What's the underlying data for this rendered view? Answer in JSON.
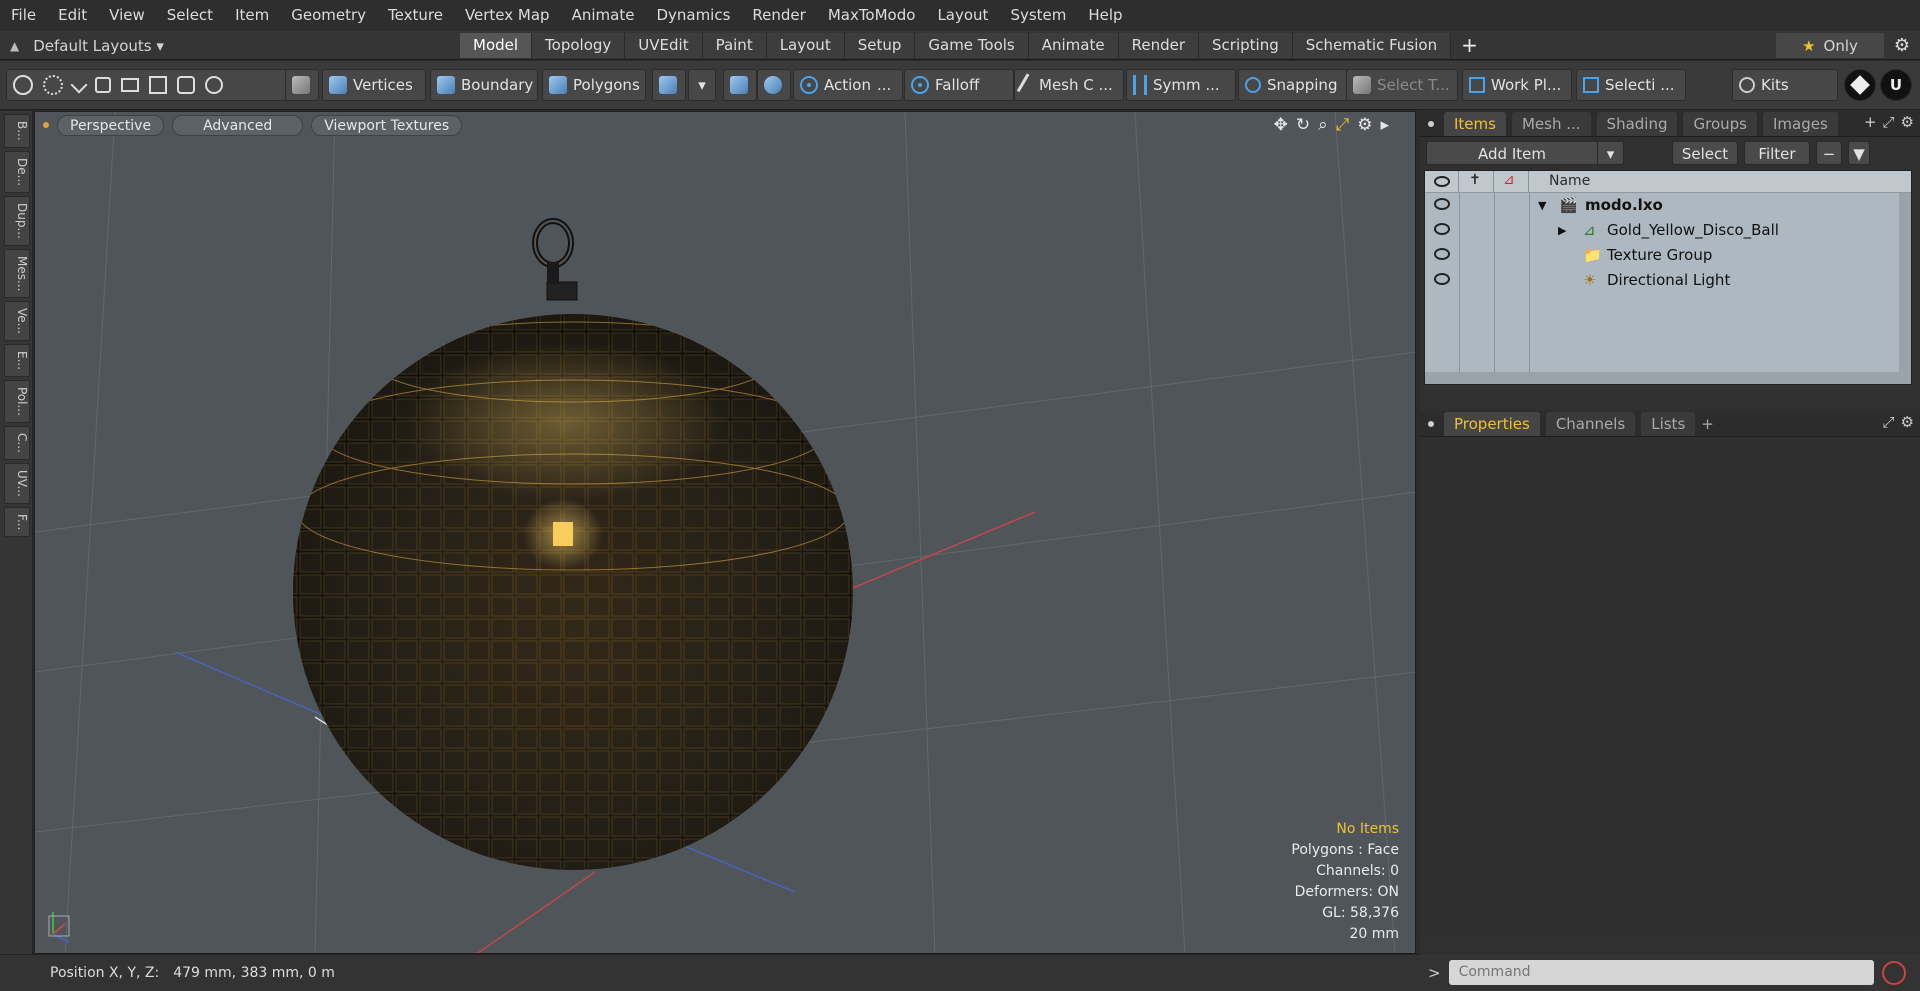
{
  "menu": [
    "File",
    "Edit",
    "View",
    "Select",
    "Item",
    "Geometry",
    "Texture",
    "Vertex Map",
    "Animate",
    "Dynamics",
    "Render",
    "MaxToModo",
    "Layout",
    "System",
    "Help"
  ],
  "layouts": {
    "label": "Default Layouts ▾"
  },
  "tabs": [
    {
      "label": "Model",
      "active": true
    },
    {
      "label": "Topology"
    },
    {
      "label": "UVEdit"
    },
    {
      "label": "Paint"
    },
    {
      "label": "Layout"
    },
    {
      "label": "Setup"
    },
    {
      "label": "Game Tools"
    },
    {
      "label": "Animate"
    },
    {
      "label": "Render"
    },
    {
      "label": "Scripting"
    },
    {
      "label": "Schematic Fusion"
    }
  ],
  "tabbar": {
    "plus": "+",
    "only": "Only",
    "star": "★",
    "gear": "⚙"
  },
  "toolbar": {
    "vertices": "Vertices",
    "boundary": "Boundary",
    "polygons": "Polygons",
    "action": "Action",
    "action_more": "...",
    "falloff": "Falloff",
    "mesh": "Mesh C ...",
    "symmetry": "Symm ...",
    "snapping": "Snapping",
    "select_t": "Select T...",
    "workplane": "Work Pl...",
    "selection": "Selecti ...",
    "kits": "Kits",
    "dropdown": "▾"
  },
  "leftstrip": [
    "B...",
    "De...",
    "Dup...",
    "Mes...",
    "Ve...",
    "E...",
    "Pol...",
    "C...",
    "UV...",
    "F..."
  ],
  "viewport": {
    "header": [
      "Perspective",
      "Advanced",
      "Viewport Textures"
    ],
    "icons": [
      "✥",
      "↻",
      "⌕",
      "⤢",
      "⚙",
      "▸"
    ],
    "info": {
      "selection": "No Items",
      "polygons": "Polygons : Face",
      "channels": "Channels: 0",
      "deformers": "Deformers: ON",
      "gl": "GL: 58,376",
      "units": "20 mm"
    }
  },
  "status": {
    "label": "Position X, Y, Z:",
    "value": "479 mm, 383 mm, 0 m"
  },
  "items_panel": {
    "tabs": [
      {
        "label": "Items",
        "active": true
      },
      {
        "label": "Mesh ..."
      },
      {
        "label": "Shading"
      },
      {
        "label": "Groups"
      },
      {
        "label": "Images"
      }
    ],
    "add_item": "Add Item",
    "add_item_arrow": "▾",
    "select": "Select",
    "filter": "Filter",
    "column_name": "Name",
    "plus": "+",
    "rows": [
      {
        "name": "modo.lxo",
        "arrow": "▼"
      },
      {
        "name": "Gold_Yellow_Disco_Ball",
        "arrow": "▶"
      },
      {
        "name": "Texture Group",
        "arrow": ""
      },
      {
        "name": "Directional Light",
        "arrow": ""
      }
    ]
  },
  "props_panel": {
    "tabs": [
      {
        "label": "Properties",
        "active": true
      },
      {
        "label": "Channels"
      },
      {
        "label": "Lists"
      }
    ],
    "plus": "+"
  },
  "command": {
    "placeholder": "Command",
    "prompt": ">"
  },
  "colors": {
    "accent": "#f0c030",
    "viewport_bg": "#4f5559",
    "gold": "#e8b040"
  }
}
